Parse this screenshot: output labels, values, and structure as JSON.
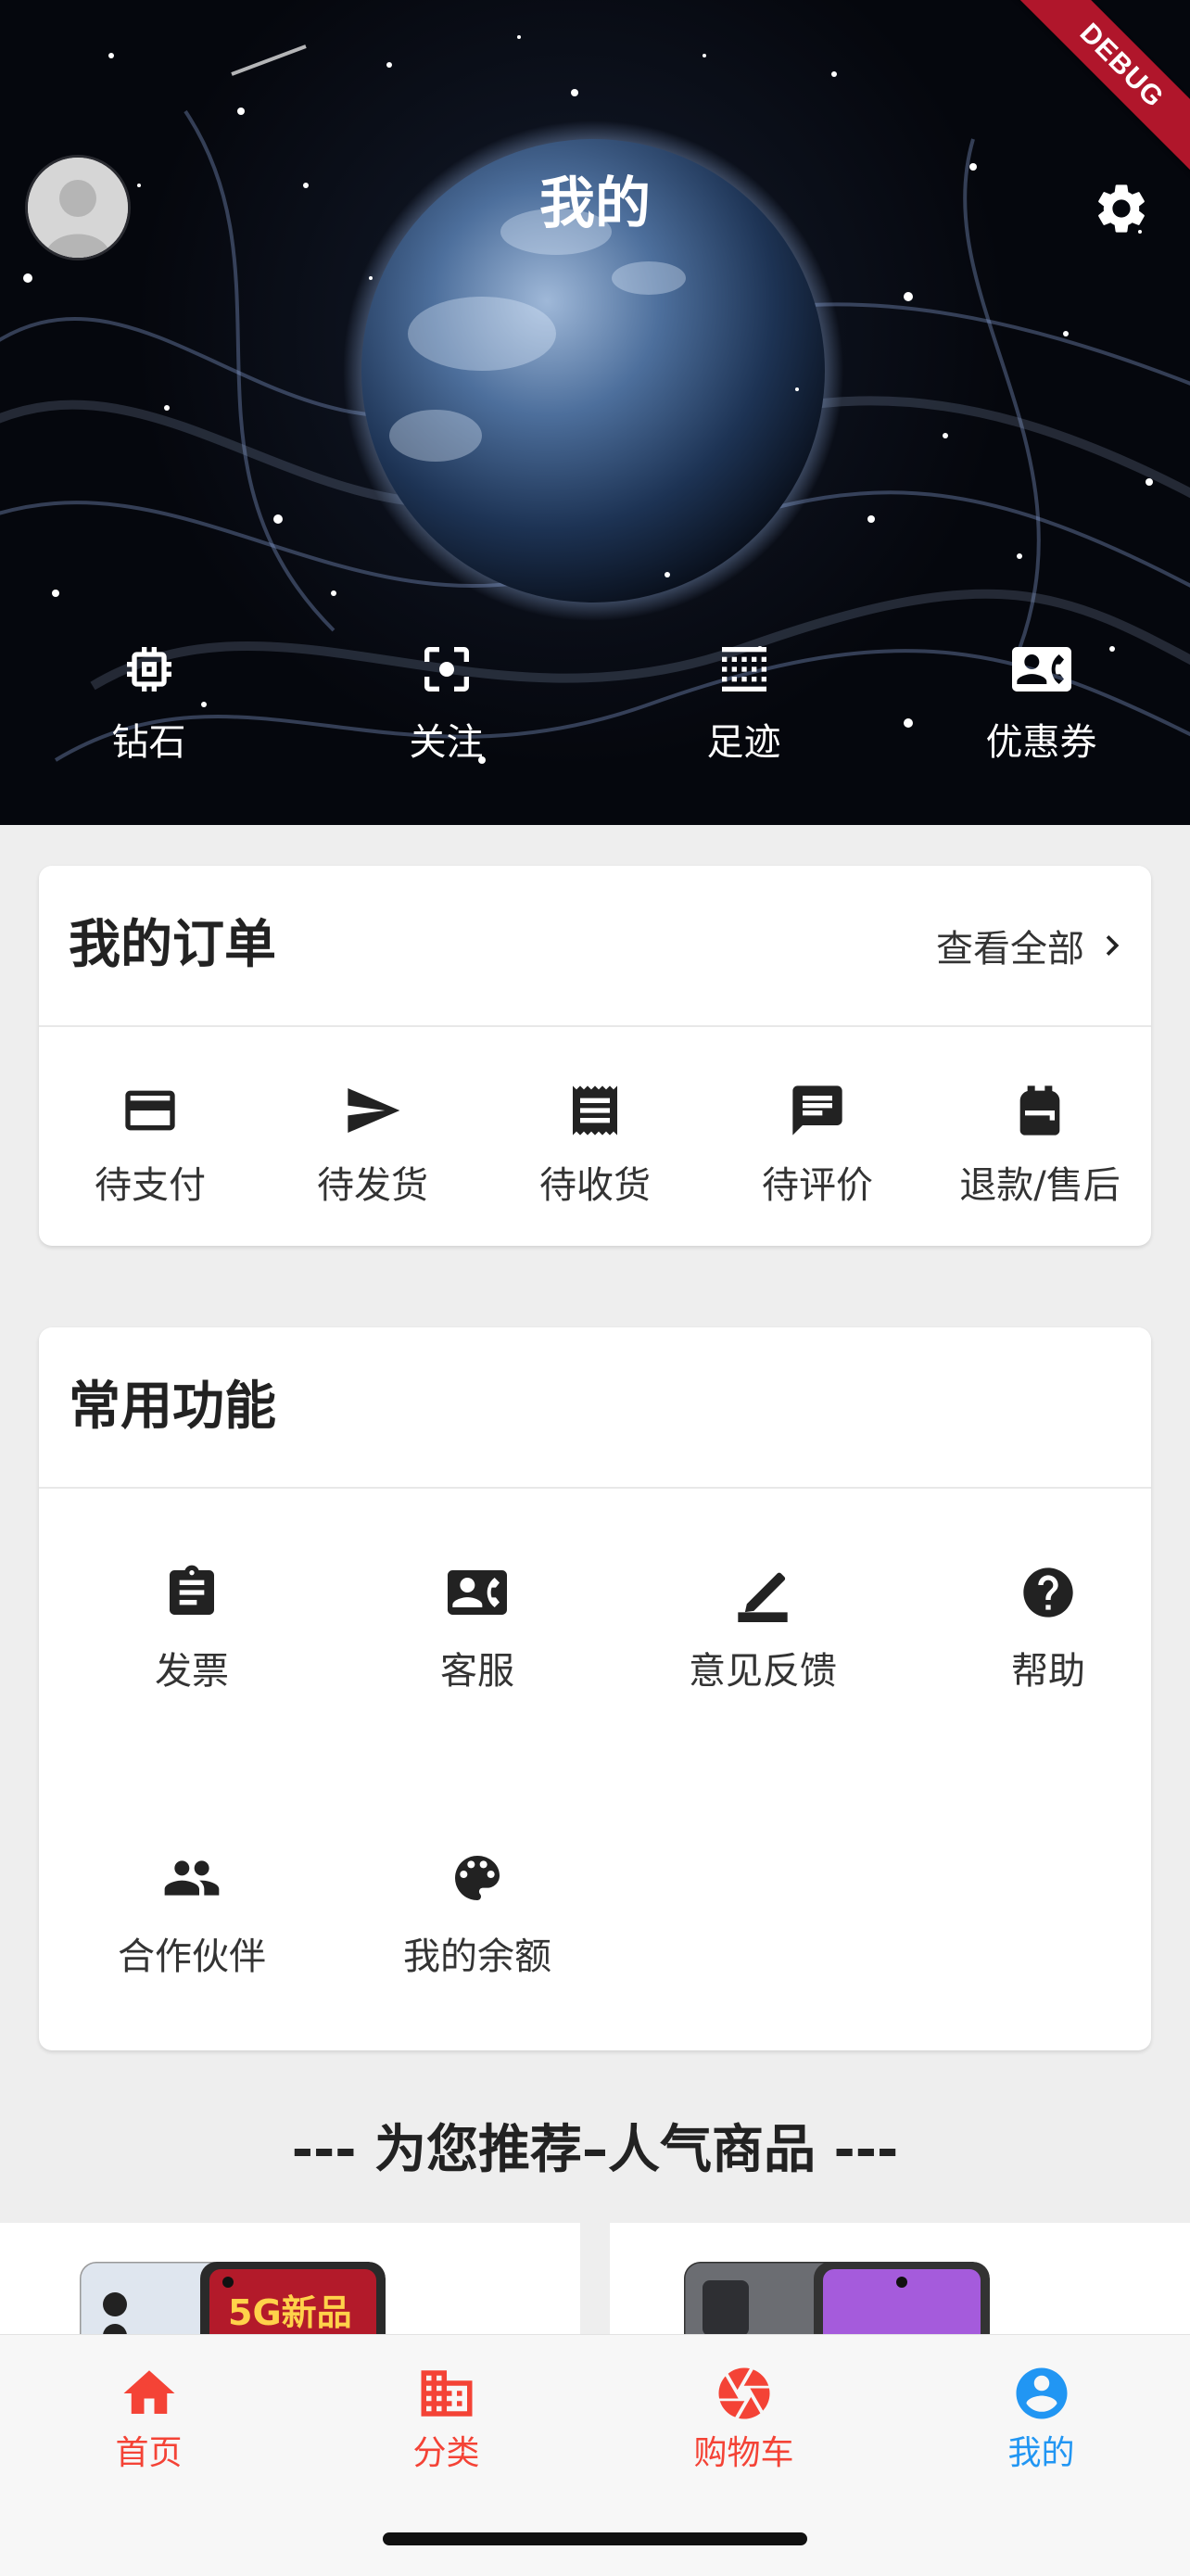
{
  "header": {
    "title": "我的",
    "debug_label": "DEBUG",
    "quick_items": [
      {
        "label": "钻石",
        "icon": "chip-icon"
      },
      {
        "label": "关注",
        "icon": "focus-icon"
      },
      {
        "label": "足迹",
        "icon": "grid-dots-icon"
      },
      {
        "label": "优惠券",
        "icon": "contact-card-icon"
      }
    ]
  },
  "orders": {
    "title": "我的订单",
    "view_all": "查看全部",
    "items": [
      {
        "label": "待支付",
        "icon": "credit-card-icon"
      },
      {
        "label": "待发货",
        "icon": "send-icon"
      },
      {
        "label": "待收货",
        "icon": "receipt-icon"
      },
      {
        "label": "待评价",
        "icon": "comment-icon"
      },
      {
        "label": "退款/售后",
        "icon": "backpack-icon"
      }
    ]
  },
  "functions": {
    "title": "常用功能",
    "items": [
      {
        "label": "发票",
        "icon": "clipboard-icon"
      },
      {
        "label": "客服",
        "icon": "contact-phone-icon"
      },
      {
        "label": "意见反馈",
        "icon": "edit-icon"
      },
      {
        "label": "帮助",
        "icon": "help-icon"
      },
      {
        "label": "合作伙伴",
        "icon": "people-icon"
      },
      {
        "label": "我的余额",
        "icon": "palette-icon"
      }
    ]
  },
  "recommend": {
    "title": "--- 为您推荐–人气商品 ---",
    "products": [
      {
        "badge": "5G新品"
      },
      {
        "badge": ""
      }
    ]
  },
  "bottom_nav": {
    "items": [
      {
        "label": "首页",
        "icon": "home-icon",
        "active": false
      },
      {
        "label": "分类",
        "icon": "building-icon",
        "active": false
      },
      {
        "label": "购物车",
        "icon": "shutter-icon",
        "active": false
      },
      {
        "label": "我的",
        "icon": "account-circle-icon",
        "active": true
      }
    ]
  },
  "colors": {
    "nav_inactive": "#f44336",
    "nav_active": "#2196f3",
    "debug_ribbon": "#b0162b"
  }
}
